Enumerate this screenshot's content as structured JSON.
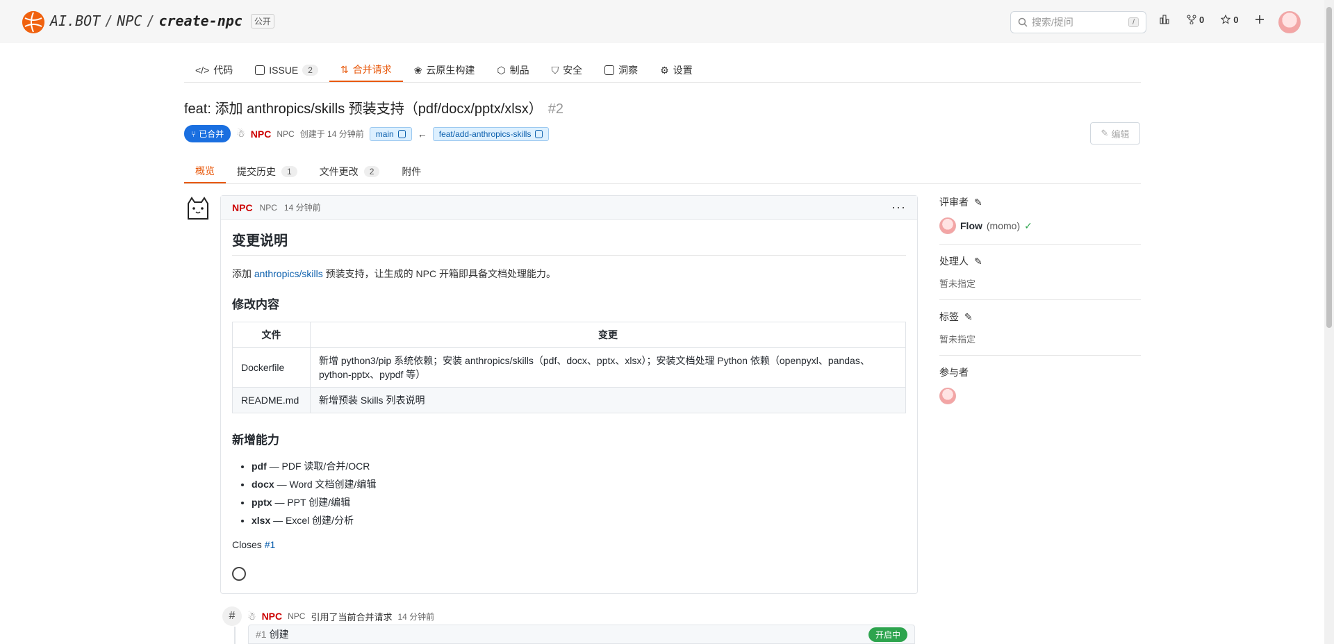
{
  "header": {
    "org": "AI.BOT",
    "group": "NPC",
    "repo": "create-npc",
    "visibility": "公开",
    "search_placeholder": "搜索/提问",
    "search_kbd": "/",
    "fork_count": "0",
    "star_count": "0"
  },
  "tabs": [
    {
      "label": "代码"
    },
    {
      "label": "ISSUE",
      "count": "2"
    },
    {
      "label": "合并请求"
    },
    {
      "label": "云原生构建"
    },
    {
      "label": "制品"
    },
    {
      "label": "安全"
    },
    {
      "label": "洞察"
    },
    {
      "label": "设置"
    }
  ],
  "pr": {
    "title": "feat: 添加 anthropics/skills 预装支持（pdf/docx/pptx/xlsx）",
    "number": "#2",
    "status": "已合并",
    "author": "NPC",
    "author_sub": "NPC",
    "created": "创建于 14 分钟前",
    "target_branch": "main",
    "source_branch": "feat/add-anthropics-skills",
    "edit_label": "编辑"
  },
  "subtabs": [
    {
      "label": "概览"
    },
    {
      "label": "提交历史",
      "count": "1"
    },
    {
      "label": "文件更改",
      "count": "2"
    },
    {
      "label": "附件"
    }
  ],
  "comment": {
    "author": "NPC",
    "author_sub": "NPC",
    "time": "14 分钟前",
    "menu": "···",
    "heading": "变更说明",
    "intro_prefix": "添加 ",
    "intro_link": "anthropics/skills",
    "intro_suffix": " 预装支持，让生成的 NPC 开箱即具备文档处理能力。",
    "changes_heading": "修改内容",
    "table_headers": [
      "文件",
      "变更"
    ],
    "table_rows": [
      {
        "file": "Dockerfile",
        "change": "新增 python3/pip 系统依赖；安装 anthropics/skills（pdf、docx、pptx、xlsx）；安装文档处理 Python 依赖（openpyxl、pandas、python-pptx、pypdf 等）"
      },
      {
        "file": "README.md",
        "change": "新增预装 Skills 列表说明"
      }
    ],
    "features_heading": "新增能力",
    "features": [
      {
        "name": "pdf",
        "desc": " — PDF 读取/合并/OCR"
      },
      {
        "name": "docx",
        "desc": " — Word 文档创建/编辑"
      },
      {
        "name": "pptx",
        "desc": " — PPT 创建/编辑"
      },
      {
        "name": "xlsx",
        "desc": " — Excel 创建/分析"
      }
    ],
    "closes_prefix": "Closes ",
    "closes_link": "#1"
  },
  "reference": {
    "author": "NPC",
    "author_sub": "NPC",
    "action": "引用了当前合并请求",
    "time": "14 分钟前",
    "issue_number": "#1",
    "issue_title": "创建",
    "issue_status": "开启中"
  },
  "sidebar": {
    "reviewers_title": "评审者",
    "reviewer_name": "Flow",
    "reviewer_sub": "(momo)",
    "assignee_title": "处理人",
    "assignee_value": "暂未指定",
    "labels_title": "标签",
    "labels_value": "暂未指定",
    "participants_title": "参与者"
  },
  "colors": {
    "accent": "#e8590c",
    "merged": "#1a6fe0",
    "open": "#2da44e",
    "author": "#cc0000"
  }
}
